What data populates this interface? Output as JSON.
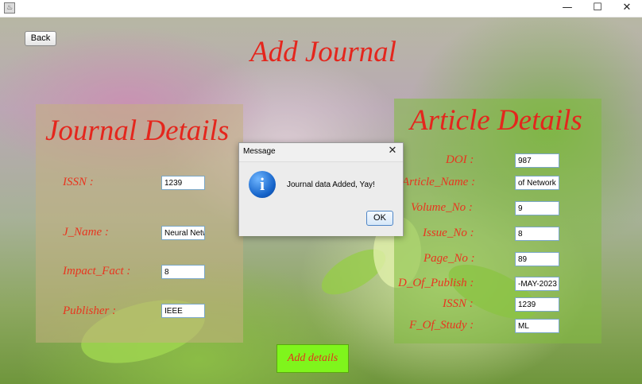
{
  "window": {
    "icon": "java-cup-icon",
    "minimize_glyph": "—",
    "maximize_glyph": "☐",
    "close_glyph": "✕"
  },
  "header": {
    "back_label": "Back",
    "title": "Add Journal"
  },
  "journal": {
    "title": "Journal Details",
    "fields": [
      {
        "label": "ISSN :",
        "value": "1239"
      },
      {
        "label": "J_Name :",
        "value": "Neural Netw"
      },
      {
        "label": "Impact_Fact :",
        "value": "8"
      },
      {
        "label": "Publisher :",
        "value": "IEEE"
      }
    ]
  },
  "article": {
    "title": "Article Details",
    "fields": [
      {
        "label": "DOI :",
        "value": "987"
      },
      {
        "label": "Article_Name :",
        "value": "of Network"
      },
      {
        "label": "Volume_No :",
        "value": "9"
      },
      {
        "label": "Issue_No :",
        "value": "8"
      },
      {
        "label": "Page_No :",
        "value": "89"
      },
      {
        "label": "D_Of_Publish :",
        "value": "-MAY-2023"
      },
      {
        "label": "ISSN :",
        "value": "1239"
      },
      {
        "label": "F_Of_Study :",
        "value": "ML"
      }
    ]
  },
  "footer": {
    "add_label": "Add details"
  },
  "dialog": {
    "title": "Message",
    "close_glyph": "✕",
    "icon": "info-icon",
    "icon_glyph": "i",
    "message": "Journal data Added, Yay!",
    "ok_label": "OK"
  }
}
